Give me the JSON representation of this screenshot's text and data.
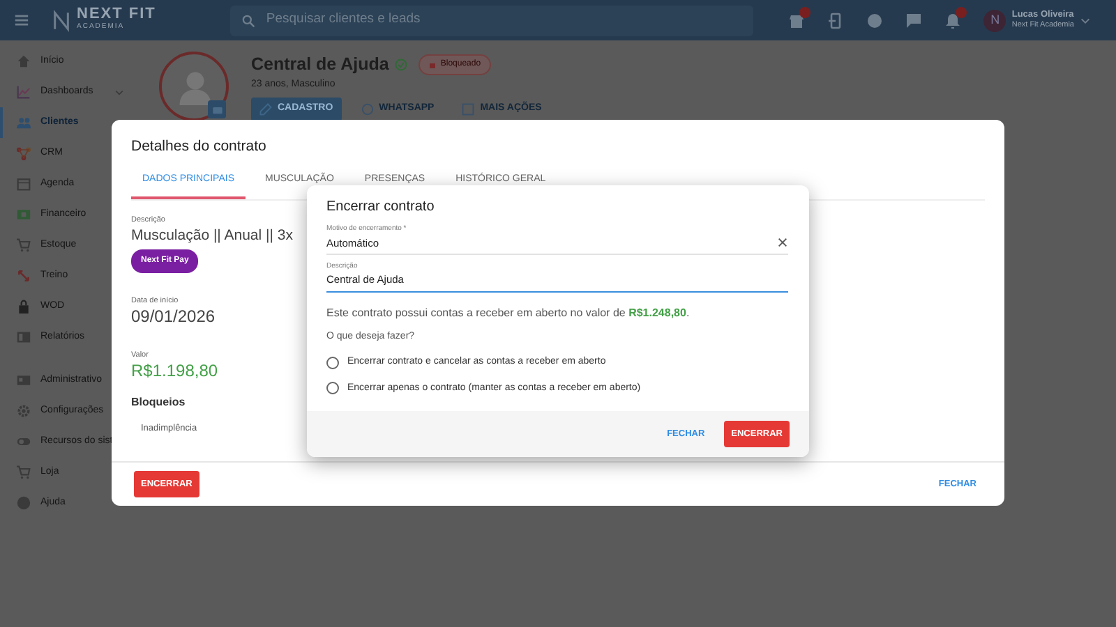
{
  "topbar": {
    "logo": {
      "name": "NEXT FIT",
      "sub": "ACADEMIA"
    },
    "search": {
      "placeholder": "Pesquisar clientes e leads"
    },
    "user": {
      "initial": "N",
      "name": "Lucas Oliveira",
      "org": "Next Fit Academia"
    }
  },
  "sidebar": {
    "items": [
      {
        "label": "Início",
        "kind": "link",
        "selected": false
      },
      {
        "label": "Dashboards",
        "kind": "group",
        "selected": false
      },
      {
        "label": "Clientes",
        "kind": "link",
        "selected": true
      },
      {
        "label": "CRM",
        "kind": "link",
        "selected": false
      },
      {
        "label": "Agenda",
        "kind": "link",
        "selected": false
      },
      {
        "label": "Financeiro",
        "kind": "link",
        "selected": false
      },
      {
        "label": "Estoque",
        "kind": "link",
        "selected": false
      },
      {
        "label": "Treino",
        "kind": "link",
        "selected": false
      },
      {
        "label": "WOD",
        "kind": "link",
        "selected": false
      },
      {
        "label": "Relatórios",
        "kind": "link",
        "selected": false
      },
      {
        "label": "Administrativo",
        "kind": "link",
        "selected": false
      },
      {
        "label": "Configurações",
        "kind": "link",
        "selected": false
      },
      {
        "label": "Recursos do sist",
        "kind": "link",
        "selected": false
      },
      {
        "label": "Loja",
        "kind": "link",
        "selected": false
      },
      {
        "label": "Ajuda",
        "kind": "link",
        "selected": false
      }
    ]
  },
  "profile": {
    "name": "Central de Ajuda",
    "status": "Bloqueado",
    "subtitle": "23 anos, Masculino",
    "actions": [
      {
        "label": "CADASTRO",
        "selected": true
      },
      {
        "label": "WHATSAPP",
        "selected": false
      },
      {
        "label": "MAIS AÇÕES",
        "selected": false
      }
    ]
  },
  "contract_modal": {
    "title": "Detalhes do contrato",
    "tabs": [
      {
        "label": "DADOS PRINCIPAIS",
        "selected": true
      },
      {
        "label": "MUSCULAÇÃO",
        "selected": false
      },
      {
        "label": "PRESENÇAS",
        "selected": false
      },
      {
        "label": "HISTÓRICO GERAL",
        "selected": false
      }
    ],
    "description": {
      "label": "Descrição",
      "value": "Musculação || Anual || 3x"
    },
    "tag": "Next Fit Pay",
    "start_date": {
      "label": "Data de início",
      "value": "09/01/2026"
    },
    "price": {
      "label": "Valor",
      "value": "R$1.198,80"
    },
    "blocks": {
      "title": "Bloqueios",
      "items": [
        "Inadimplência"
      ]
    },
    "buttons": [
      {
        "label": "ENCERRAR",
        "kind": "danger"
      },
      {
        "label": "FECHAR",
        "kind": "text"
      }
    ]
  },
  "dialog": {
    "title": "Encerrar contrato",
    "fields": [
      {
        "label": "Motivo de encerramento *",
        "value": "Automático",
        "kind": "select",
        "focused": false
      },
      {
        "label": "Descrição",
        "value": "Central de Ajuda",
        "kind": "text",
        "focused": true
      }
    ],
    "message": "Este contrato possui contas a receber em aberto no valor de **R$1.248,80**.",
    "question": "O que deseja fazer?",
    "options": [
      {
        "label": "Encerrar contrato e cancelar as contas a receber em aberto",
        "selected": false
      },
      {
        "label": "Encerrar apenas o contrato (manter as contas a receber em aberto)",
        "selected": false
      }
    ],
    "buttons": [
      {
        "label": "FECHAR",
        "kind": "text"
      },
      {
        "label": "ENCERRAR",
        "kind": "danger"
      }
    ]
  }
}
